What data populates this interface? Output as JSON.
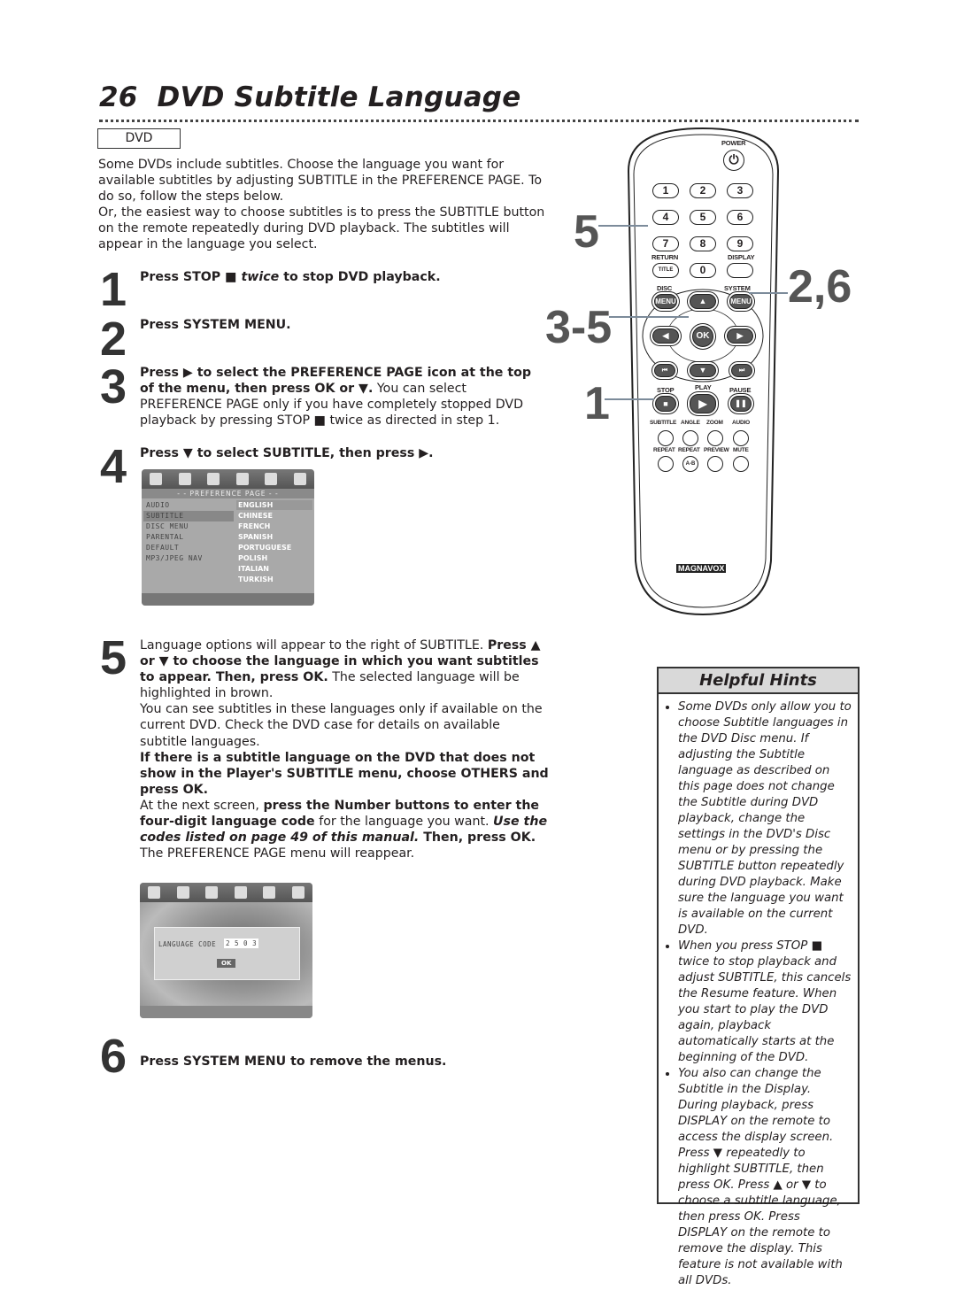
{
  "page": {
    "number": "26",
    "title": "DVD Subtitle Language",
    "badge": "DVD"
  },
  "intro": [
    [
      {
        "t": "Some DVDs include subtitles. Choose the language you want for available subtitles by adjusting SUBTITLE in the PREFERENCE PAGE. To do so, follow the steps below."
      }
    ],
    [
      {
        "t": "Or, the easiest way to choose subtitles is to press the SUBTITLE button on the remote repeatedly during DVD playback. The subtitles will appear in the language you select."
      }
    ]
  ],
  "steps": [
    {
      "num": "1",
      "paras": [
        [
          {
            "t": "Press STOP ■ ",
            "b": true
          },
          {
            "t": "twice",
            "b": true,
            "i": true
          },
          {
            "t": " to stop DVD playback.",
            "b": true
          }
        ]
      ]
    },
    {
      "num": "2",
      "paras": [
        [
          {
            "t": "Press SYSTEM MENU.",
            "b": true
          }
        ]
      ]
    },
    {
      "num": "3",
      "paras": [
        [
          {
            "t": "Press ▶ to select the PREFERENCE PAGE icon at the top of the menu, then press OK or ▼.",
            "b": true
          },
          {
            "t": " You can select PREFERENCE PAGE only if you have completely stopped DVD playback by pressing STOP ■ twice as directed in step 1."
          }
        ]
      ]
    },
    {
      "num": "4",
      "paras": [
        [
          {
            "t": "Press ▼ to select SUBTITLE, then press ▶.",
            "b": true
          }
        ]
      ]
    },
    {
      "num": "5",
      "paras": [
        [
          {
            "t": "Language options will appear to the right of SUBTITLE. "
          },
          {
            "t": "Press ▲ or ▼ to choose the language in which you want subtitles to appear. Then, press OK.",
            "b": true
          },
          {
            "t": " The selected language will be highlighted in brown."
          }
        ],
        [
          {
            "t": "You can see subtitles in these languages only if available on the current DVD. Check the DVD case for details on available subtitle languages."
          }
        ],
        [
          {
            "t": "If there is a subtitle language on the DVD that does not show in the Player's SUBTITLE menu, choose OTHERS and press OK.",
            "b": true
          }
        ],
        [
          {
            "t": "At the next screen, "
          },
          {
            "t": "press the Number buttons to enter the four-digit language code",
            "b": true
          },
          {
            "t": " for the language you want. "
          },
          {
            "t": "Use the codes listed on page 49 of this manual.",
            "b": true,
            "i": true
          },
          {
            "t": " Then, press OK.",
            "b": true
          },
          {
            "t": " The PREFERENCE PAGE menu will reappear."
          }
        ]
      ]
    },
    {
      "num": "6",
      "paras": [
        [
          {
            "t": "Press SYSTEM MENU to remove the menus.",
            "b": true
          }
        ]
      ]
    }
  ],
  "menu_screen": {
    "header": "- -  PREFERENCE  PAGE  - -",
    "items": [
      "AUDIO",
      "SUBTITLE",
      "DISC  MENU",
      "PARENTAL",
      "DEFAULT",
      "MP3/JPEG  NAV"
    ],
    "selected_item": "SUBTITLE",
    "languages": [
      "ENGLISH",
      "CHINESE",
      "FRENCH",
      "SPANISH",
      "PORTUGUESE",
      "POLISH",
      "ITALIAN",
      "TURKISH"
    ]
  },
  "code_screen": {
    "label": "LANGUAGE  CODE",
    "code": "2 5 0 3",
    "ok": "OK"
  },
  "remote": {
    "power": "POWER",
    "nums": [
      "1",
      "2",
      "3",
      "4",
      "5",
      "6",
      "7",
      "8",
      "9",
      "0"
    ],
    "return": "RETURN",
    "title": "TITLE",
    "display": "DISPLAY",
    "disc": "DISC",
    "system": "SYSTEM",
    "menu": "MENU",
    "ok": "OK",
    "stop": "STOP",
    "play": "PLAY",
    "pause": "PAUSE",
    "subtitle": "SUBTITLE",
    "angle": "ANGLE",
    "zoom": "ZOOM",
    "audio": "AUDIO",
    "repeat": "REPEAT",
    "repeat_ab": "REPEAT",
    "ab": "A-B",
    "preview": "PREVIEW",
    "mute": "MUTE",
    "brand": "MAGNAVOX"
  },
  "callouts": {
    "c5": "5",
    "c35": "3-5",
    "c1": "1",
    "c26": "2,6"
  },
  "hints": {
    "title": "Helpful Hints",
    "items": [
      "Some DVDs only allow you to choose Subtitle languages in the DVD Disc menu. If adjusting the Subtitle language as described on this page does not change the Subtitle during DVD playback, change the settings in the DVD's Disc menu or by pressing the SUBTITLE button repeatedly during DVD playback. Make sure the language you want is available on the current DVD.",
      "When you press STOP ■ twice to stop playback and adjust SUBTITLE, this cancels the Resume feature. When you start to play the DVD again, playback automatically starts at the beginning of the DVD.",
      "You also can change the Subtitle in the Display. During playback, press DISPLAY on the remote to access the display screen. Press ▼ repeatedly to highlight SUBTITLE, then press OK. Press ▲ or ▼ to choose a subtitle language, then press OK. Press DISPLAY on the remote to remove the display. This feature is not available with all DVDs."
    ]
  }
}
